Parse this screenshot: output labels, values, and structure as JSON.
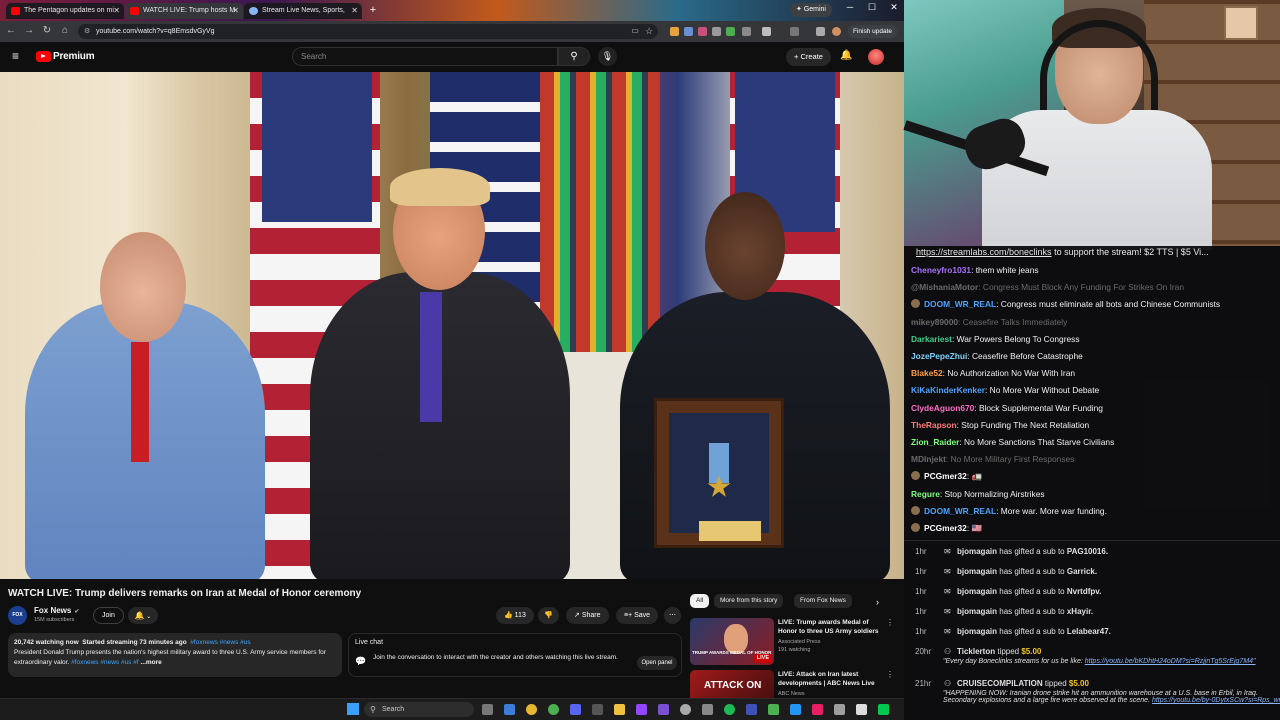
{
  "browser": {
    "tabs": [
      {
        "label": "The Pentagon updates on mi",
        "active": false
      },
      {
        "label": "WATCH LIVE: Trump hosts M",
        "active": true
      },
      {
        "label": "Stream Live News, Sports,",
        "active": false
      }
    ],
    "gemini_label": "Gemini",
    "url": "youtube.com/watch?v=q8EmsdvGyVg",
    "finish_update_label": "Finish update"
  },
  "youtube": {
    "brand": "Premium",
    "search_placeholder": "Search",
    "create_label": "Create",
    "video": {
      "title": "WATCH LIVE: Trump delivers remarks on Iran at Medal of Honor ceremony",
      "channel": "Fox News",
      "subscribers": "15M subscribers",
      "join_label": "Join",
      "likes": "113",
      "share_label": "Share",
      "save_label": "Save",
      "watching": "20,742 watching now",
      "started": "Started streaming 73 minutes ago",
      "hashtags": "#foxnews #news #us",
      "description": "President Donald Trump presents the nation's highest military award to three U.S. Army service members for extraordinary valor.",
      "desc_tags": "#foxnews #news #us #f",
      "more_label": "...more",
      "progress_fraction": 1.0
    },
    "live_chat": {
      "title": "Live chat",
      "text": "Join the conversation to interact with the creator and others watching this live stream.",
      "open_panel_label": "Open panel"
    },
    "chips": [
      "All",
      "More from this story",
      "From Fox News"
    ],
    "recommendations": [
      {
        "title": "LIVE: Trump awards Medal of Honor to three US Army soldiers",
        "channel": "Associated Press",
        "meta": "191 watching",
        "thumb_text": "TRUMP AWARDS MEDAL OF HONOR"
      },
      {
        "title": "LIVE: Attack on Iran latest developments | ABC News Live",
        "channel": "ABC News",
        "meta": "",
        "thumb_text": "ATTACK ON"
      }
    ]
  },
  "stream_overlay": {
    "banner_link": "https://streamlabs.com/boneclinks",
    "banner_text": "to support the stream! $2 TTS | $5 Vi...",
    "chat": [
      {
        "user": "Cheneyfro1031",
        "message": "them white jeans",
        "color": "#a970ff",
        "dim": false,
        "badge": false
      },
      {
        "user": "@MishaniaMotor",
        "message": "Congress Must Block Any Funding For Strikes On Iran",
        "color": "#9a9a9a",
        "dim": true,
        "badge": false
      },
      {
        "user": "DOOM_WR_REAL",
        "message": "Congress must eliminate all bots and Chinese Communists",
        "color": "#4aa3ff",
        "dim": false,
        "badge": true
      },
      {
        "user": "mikey89000",
        "message": "Ceasefire Talks Immediately",
        "color": "#8a5a8a",
        "dim": true,
        "badge": false
      },
      {
        "user": "Darkariest",
        "message": "War Powers Belong To Congress",
        "color": "#3ecf8e",
        "dim": false,
        "badge": false
      },
      {
        "user": "JozePepeZhui",
        "message": "Ceasefire Before Catastrophe",
        "color": "#7fd4ff",
        "dim": false,
        "badge": false
      },
      {
        "user": "Blake52",
        "message": "No Authorization No War With Iran",
        "color": "#ff9f43",
        "dim": false,
        "badge": false
      },
      {
        "user": "KiKaKinderKenker",
        "message": "No More War Without Debate",
        "color": "#4aa3ff",
        "dim": false,
        "badge": false
      },
      {
        "user": "ClydeAguon670",
        "message": "Block Supplemental War Funding",
        "color": "#ff6ec7",
        "dim": false,
        "badge": false
      },
      {
        "user": "TheRapson",
        "message": "Stop Funding The Next Retaliation",
        "color": "#ff7a7a",
        "dim": false,
        "badge": false
      },
      {
        "user": "Zion_Raider",
        "message": "No More Sanctions That Starve Civilians",
        "color": "#7dff7d",
        "dim": false,
        "badge": false
      },
      {
        "user": "MDInjekt",
        "message": "No More Military First Responses",
        "color": "#777777",
        "dim": true,
        "badge": false
      },
      {
        "user": "PCGmer32",
        "message": "🚛",
        "color": "#ffffff",
        "dim": false,
        "badge": true
      },
      {
        "user": "Regure",
        "message": "Stop Normalizing Airstrikes",
        "color": "#7dff7d",
        "dim": false,
        "badge": false
      },
      {
        "user": "DOOM_WR_REAL",
        "message": "More war. More war funding.",
        "color": "#4aa3ff",
        "dim": false,
        "badge": true
      },
      {
        "user": "PCGmer32",
        "message": "🇺🇸",
        "color": "#ffffff",
        "dim": false,
        "badge": true
      }
    ],
    "events": [
      {
        "time": "1hr",
        "user": "bjomagain",
        "action": "has gifted a sub to",
        "target": "PAG10016."
      },
      {
        "time": "1hr",
        "user": "bjomagain",
        "action": "has gifted a sub to",
        "target": "Garrick."
      },
      {
        "time": "1hr",
        "user": "bjomagain",
        "action": "has gifted a sub to",
        "target": "Nvrtdfpv."
      },
      {
        "time": "1hr",
        "user": "bjomagain",
        "action": "has gifted a sub to",
        "target": "xHayir."
      },
      {
        "time": "1hr",
        "user": "bjomagain",
        "action": "has gifted a sub to",
        "target": "Lelabear47."
      }
    ],
    "tips": [
      {
        "time": "20hr",
        "user": "Ticklerton",
        "action": "tipped",
        "amount": "$5.00",
        "message": "\"Every day Boneclinks streams for us be like:",
        "link": "https://youtu.be/bKDhtH24oDM?si=RzjjnTg5SrEjg7M4\""
      },
      {
        "time": "21hr",
        "user": "CRUISECOMPILATION",
        "action": "tipped",
        "amount": "$5.00",
        "message": "\"HAPPENING NOW: Iranian drone strike hit an ammunition warehouse at a U.S. base in Erbil, in Iraq.",
        "message2": "Secondary explosions and a large fire were observed at the scene.",
        "link": "https://youtu.be/by-0DytxSCw?si=Rps_wr_u05g0Sbf3\""
      }
    ]
  },
  "taskbar": {
    "search_placeholder": "Search"
  },
  "colors": {
    "youtube_red": "#ff0000",
    "background": "#0f0f0f",
    "tip_amount": "#f5c518",
    "link": "#8ab4f8"
  }
}
